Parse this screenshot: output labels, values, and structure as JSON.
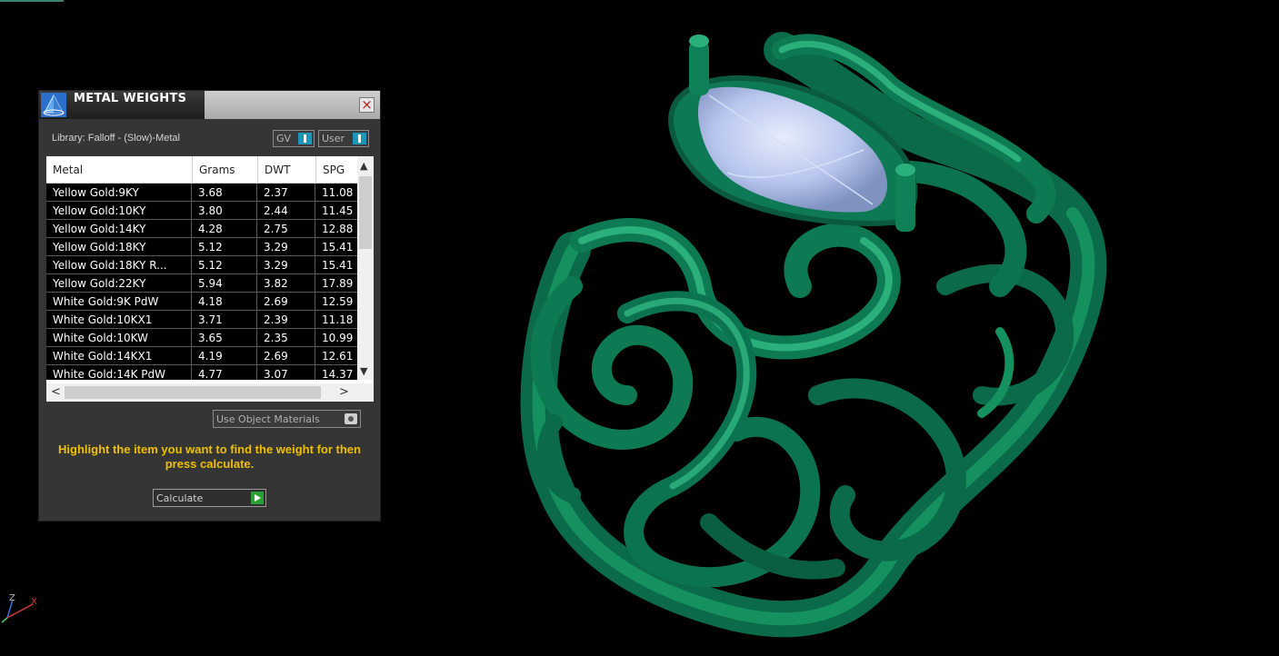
{
  "panel": {
    "title": "METAL WEIGHTS",
    "close_glyph": "×",
    "library_label": "Library: Falloff - (Slow)-Metal",
    "toggles": [
      {
        "label": "GV",
        "state": "on"
      },
      {
        "label": "User",
        "state": "on"
      }
    ],
    "table": {
      "headers": [
        "Metal",
        "Grams",
        "DWT",
        "SPG"
      ],
      "rows": [
        {
          "metal": "Yellow Gold:9KY",
          "grams": "3.68",
          "dwt": "2.37",
          "spg": "11.08"
        },
        {
          "metal": "Yellow Gold:10KY",
          "grams": "3.80",
          "dwt": "2.44",
          "spg": "11.45"
        },
        {
          "metal": "Yellow Gold:14KY",
          "grams": "4.28",
          "dwt": "2.75",
          "spg": "12.88"
        },
        {
          "metal": "Yellow Gold:18KY",
          "grams": "5.12",
          "dwt": "3.29",
          "spg": "15.41"
        },
        {
          "metal": "Yellow Gold:18KY R...",
          "grams": "5.12",
          "dwt": "3.29",
          "spg": "15.41"
        },
        {
          "metal": "Yellow Gold:22KY",
          "grams": "5.94",
          "dwt": "3.82",
          "spg": "17.89"
        },
        {
          "metal": "White Gold:9K PdW",
          "grams": "4.18",
          "dwt": "2.69",
          "spg": "12.59"
        },
        {
          "metal": "White Gold:10KX1",
          "grams": "3.71",
          "dwt": "2.39",
          "spg": "11.18"
        },
        {
          "metal": "White Gold:10KW",
          "grams": "3.65",
          "dwt": "2.35",
          "spg": "10.99"
        },
        {
          "metal": "White Gold:14KX1",
          "grams": "4.19",
          "dwt": "2.69",
          "spg": "12.61"
        },
        {
          "metal": "White Gold:14K PdW",
          "grams": "4.77",
          "dwt": "3.07",
          "spg": "14.37"
        }
      ]
    },
    "scroll_arrows": {
      "up": "▲",
      "down": "▼",
      "left": "<",
      "right": ">"
    },
    "use_object_materials_label": "Use Object Materials",
    "hint_text": "Highlight the item you want to find the weight for then press calculate.",
    "calculate_label": "Calculate"
  },
  "axes": {
    "z": "Z",
    "x": "X"
  },
  "colors": {
    "model": "#0e7a55",
    "gem": "#b8c6ee",
    "hint": "#f0c000",
    "toggle_knob": "#1d96b8",
    "calculate_go": "#29a036"
  },
  "icons": {
    "app_icon": "pyramid-icon",
    "close": "close-icon",
    "calculate": "play-icon"
  }
}
